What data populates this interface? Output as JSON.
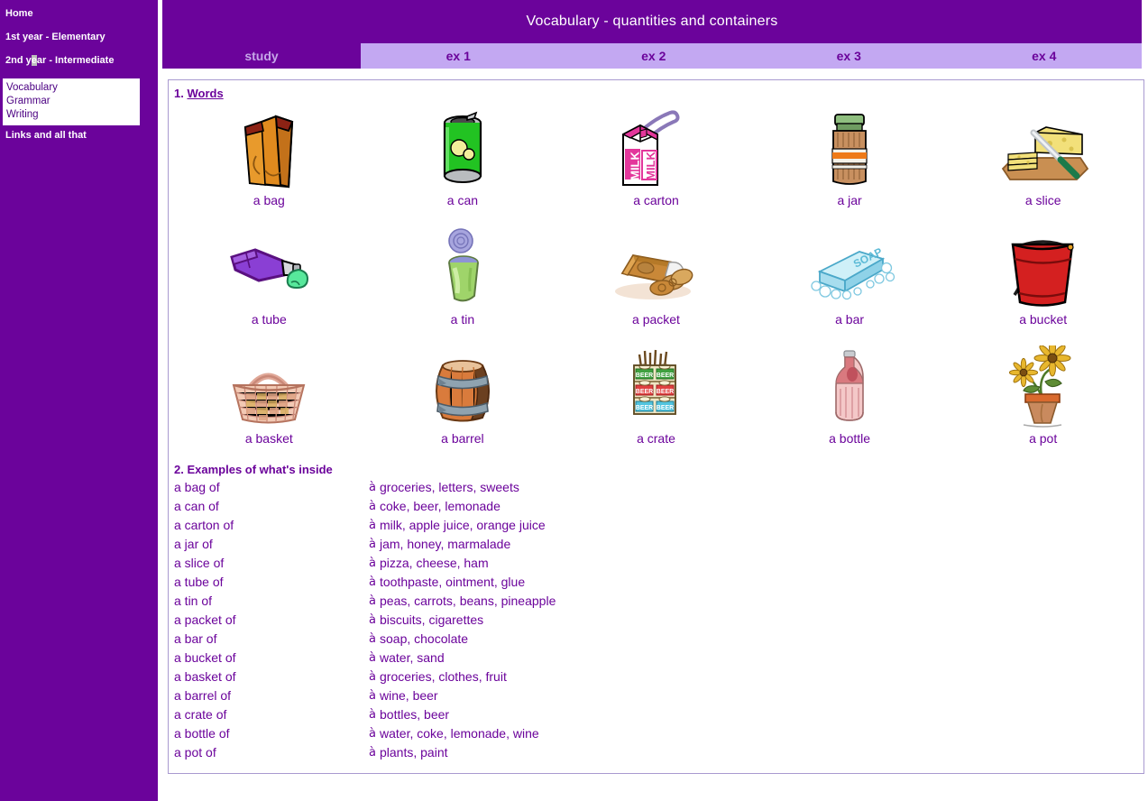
{
  "sidebar": {
    "links": [
      {
        "label": "Home",
        "selected": false
      },
      {
        "label": "1st year - Elementary",
        "selected": false
      },
      {
        "label_pre": "2nd y",
        "label_hl": "e",
        "label_post": "ar - Intermediate",
        "selected": true
      }
    ],
    "box_items": [
      "Vocabulary",
      "Grammar",
      "Writing"
    ],
    "footer_link": "Links and all that"
  },
  "banner": {
    "title": "Vocabulary - quantities and containers"
  },
  "tabs": [
    {
      "label": "study",
      "active": true
    },
    {
      "label": "ex 1",
      "active": false
    },
    {
      "label": "ex 2",
      "active": false
    },
    {
      "label": "ex 3",
      "active": false
    },
    {
      "label": "ex 4",
      "active": false
    }
  ],
  "sections": {
    "words": {
      "number": "1.",
      "title": "Words"
    },
    "examples": {
      "number": "2.",
      "title": "Examples of what's inside"
    }
  },
  "words": [
    [
      {
        "label": "a bag",
        "icon": "paper-bag-icon"
      },
      {
        "label": "a can",
        "icon": "drink-can-icon"
      },
      {
        "label": "a carton",
        "icon": "milk-carton-icon"
      },
      {
        "label": "a jar",
        "icon": "jam-jar-icon"
      },
      {
        "label": "a slice",
        "icon": "cheese-slice-icon"
      }
    ],
    [
      {
        "label": "a tube",
        "icon": "toothpaste-tube-icon"
      },
      {
        "label": "a tin",
        "icon": "open-tin-icon"
      },
      {
        "label": "a packet",
        "icon": "biscuit-packet-icon"
      },
      {
        "label": "a bar",
        "icon": "soap-bar-icon"
      },
      {
        "label": "a bucket",
        "icon": "bucket-icon"
      }
    ],
    [
      {
        "label": "a basket",
        "icon": "wicker-basket-icon"
      },
      {
        "label": "a barrel",
        "icon": "wooden-barrel-icon"
      },
      {
        "label": "a crate",
        "icon": "beer-crate-icon"
      },
      {
        "label": "a bottle",
        "icon": "soda-bottle-icon"
      },
      {
        "label": "a pot",
        "icon": "flower-pot-icon"
      }
    ]
  ],
  "arrow_glyph": "à",
  "examples": [
    {
      "term": "a bag of",
      "contents": "groceries, letters, sweets"
    },
    {
      "term": "a can of",
      "contents": "coke, beer, lemonade"
    },
    {
      "term": "a carton of",
      "contents": "milk, apple juice, orange juice"
    },
    {
      "term": "a jar of",
      "contents": "jam, honey, marmalade"
    },
    {
      "term": "a slice of",
      "contents": "pizza, cheese, ham"
    },
    {
      "term": "a tube of",
      "contents": "toothpaste, ointment, glue"
    },
    {
      "term": "a tin of",
      "contents": "peas, carrots, beans, pineapple"
    },
    {
      "term": "a packet of",
      "contents": "biscuits, cigarettes"
    },
    {
      "term": "a bar of",
      "contents": "soap, chocolate"
    },
    {
      "term": "a bucket of",
      "contents": "water, sand"
    },
    {
      "term": "a basket of",
      "contents": "groceries, clothes, fruit"
    },
    {
      "term": "a barrel of",
      "contents": "wine, beer"
    },
    {
      "term": "a crate of",
      "contents": "bottles, beer"
    },
    {
      "term": "a bottle of",
      "contents": "water, coke, lemonade, wine"
    },
    {
      "term": "a pot of",
      "contents": "plants, paint"
    }
  ],
  "colors": {
    "purple": "#6b039b",
    "lavender": "#c3a8f2",
    "tab_active_text": "#c5a6e8",
    "panel_border": "#a99ad0",
    "white": "#ffffff"
  }
}
